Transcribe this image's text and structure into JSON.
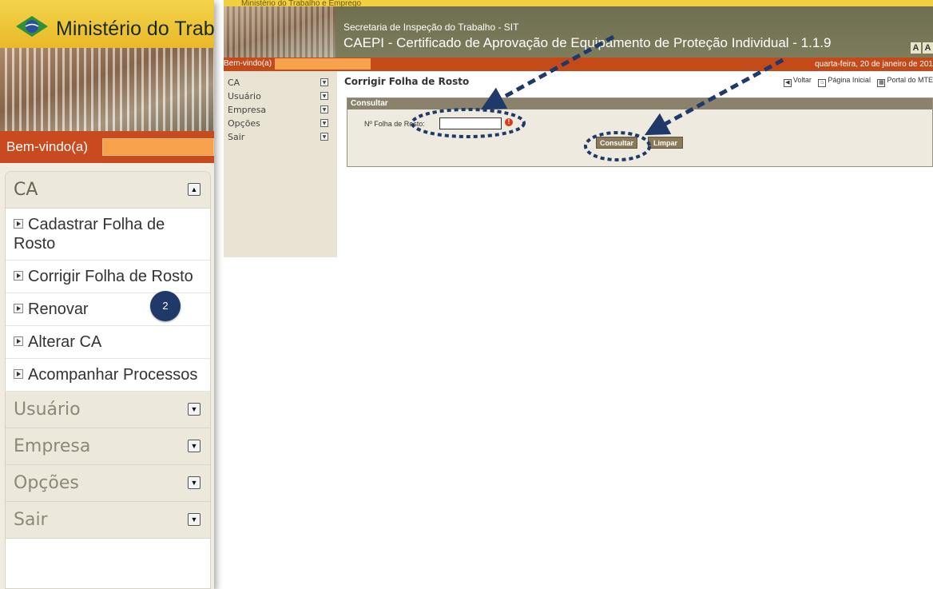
{
  "left_panel": {
    "header_title": "Ministério do Trabal",
    "welcome": "Bem-vindo(a)",
    "menu": {
      "ca_label": "CA",
      "items": [
        "Cadastrar Folha de Rosto",
        "Corrigir Folha de Rosto",
        "Renovar",
        "Alterar CA",
        "Acompanhar Processos"
      ],
      "usuario_label": "Usuário",
      "empresa_label": "Empresa",
      "opcoes_label": "Opções",
      "sair_label": "Sair"
    },
    "step_badge": "2"
  },
  "app": {
    "ministry": "Ministério do Trabalho e Emprego",
    "secretaria": "Secretaria de Inspeção do Trabalho - SIT",
    "system_title": "CAEPI - Certificado de Aprovação de Equipamento de Proteção Individual - 1.1.9",
    "font_buttons": [
      "A",
      "A"
    ],
    "welcome": "Bem-vindo(a)",
    "date": "quarta-feira, 20 de janeiro de 201",
    "sidebar": {
      "ca": "CA",
      "usuario": "Usuário",
      "empresa": "Empresa",
      "opcoes": "Opções",
      "sair": "Sair"
    },
    "page_title": "Corrigir Folha de Rosto",
    "links": {
      "voltar": "Voltar",
      "inicial": "Página Inicial",
      "portal": "Portal do MTE"
    },
    "form": {
      "title": "Consultar",
      "field_label": "Nº Folha de Rosto:",
      "field_value": "",
      "required_mark": "!",
      "consultar": "Consultar",
      "limpar": "Limpar"
    }
  },
  "colors": {
    "header_yellow": "#f1cf3e",
    "bar_orange": "#c44a1a",
    "welcome_box": "#f6a14c",
    "app_header": "#6d6e4f",
    "annotation_navy": "#1f3a68"
  }
}
